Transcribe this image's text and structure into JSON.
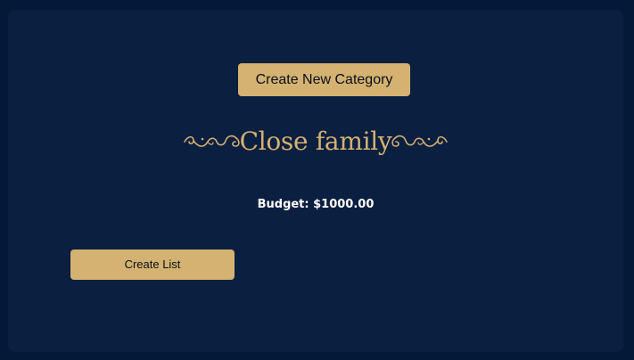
{
  "actions": {
    "create_category_label": "Create New Category",
    "create_list_label": "Create List"
  },
  "category": {
    "name": "Close family",
    "budget_text": "Budget: $1000.00"
  },
  "colors": {
    "page_background": "#021a37",
    "panel_background": "#0b1f40",
    "accent_gold": "#d4b272",
    "text_white": "#ffffff"
  },
  "icons": {
    "title_left_ornament": "flourish-icon",
    "title_right_ornament": "flourish-icon"
  }
}
